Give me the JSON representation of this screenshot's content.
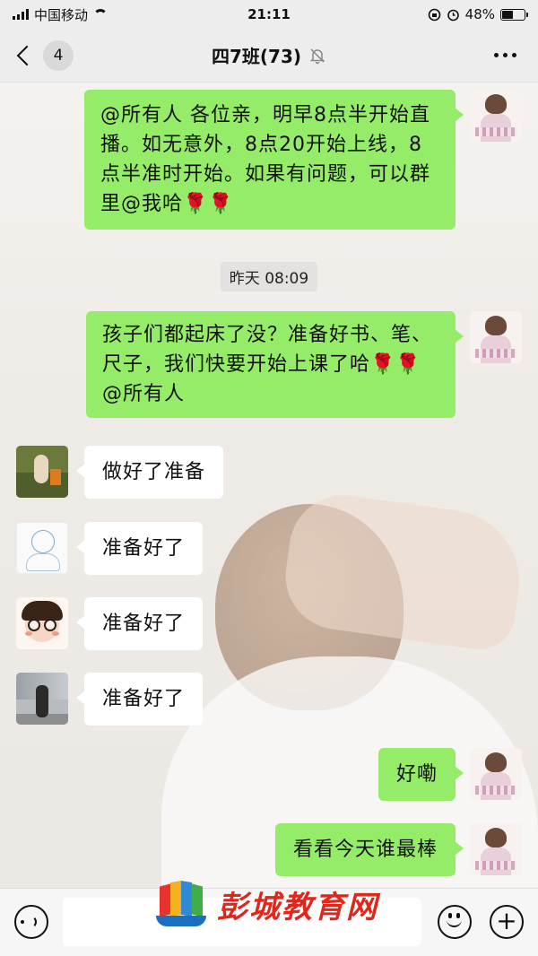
{
  "status_bar": {
    "carrier": "中国移动",
    "time": "21:11",
    "battery_percent": "48%",
    "battery_level": 0.48
  },
  "nav": {
    "back_badge": "4",
    "title": "四7班(73)",
    "icons": [
      "chevron-left-icon",
      "mute-bell-icon",
      "more-icon"
    ]
  },
  "messages": [
    {
      "side": "right",
      "avatar": "teacher-avatar",
      "text": "@所有人 各位亲，明早8点半开始直播。如无意外，8点20开始上线，8点半准时开始。如果有问题，可以群里@我哈🌹🌹"
    },
    {
      "type": "timestamp",
      "text": "昨天 08:09"
    },
    {
      "side": "right",
      "avatar": "teacher-avatar",
      "text": "孩子们都起床了没？准备好书、笔、尺子，我们快要开始上课了哈🌹🌹@所有人"
    },
    {
      "side": "left",
      "avatar": "kid-grass-avatar",
      "text": "做好了准备"
    },
    {
      "side": "left",
      "avatar": "sketch-avatar",
      "text": "准备好了"
    },
    {
      "side": "left",
      "avatar": "cartoon-girl-avatar",
      "text": "准备好了"
    },
    {
      "side": "left",
      "avatar": "street-photo-avatar",
      "text": "准备好了"
    },
    {
      "side": "right",
      "avatar": "teacher-avatar",
      "text": "好嘞"
    },
    {
      "side": "right",
      "avatar": "teacher-avatar",
      "text": "看看今天谁最棒"
    }
  ],
  "input_bar": {
    "icons": [
      "voice-icon",
      "emoji-icon",
      "plus-icon"
    ]
  },
  "watermark": {
    "text": "彭城教育网"
  },
  "colors": {
    "self_bubble": "#95ec69",
    "other_bubble": "#ffffff",
    "background": "#ededed",
    "watermark_red": "#e1261c"
  }
}
